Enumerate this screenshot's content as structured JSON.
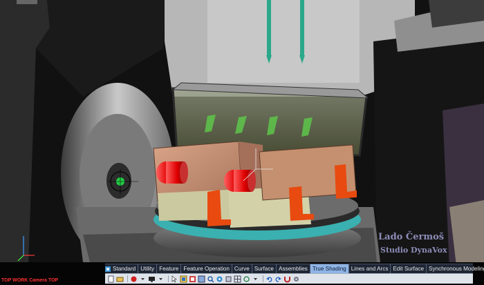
{
  "viewport": {
    "view_label": "TOP WORK Camera TOP"
  },
  "watermark": {
    "name": "Lado Čermoš",
    "studio": "Studio DynaVox"
  },
  "ribbon": {
    "tabs": [
      {
        "label": "Standard",
        "active": false
      },
      {
        "label": "Utility",
        "active": false
      },
      {
        "label": "Feature",
        "active": false
      },
      {
        "label": "Feature Operation",
        "active": false
      },
      {
        "label": "Curve",
        "active": false
      },
      {
        "label": "Surface",
        "active": false
      },
      {
        "label": "Assemblies",
        "active": false
      },
      {
        "label": "True Shading",
        "active": true
      },
      {
        "label": "Lines and Arcs",
        "active": false
      },
      {
        "label": "Edit Surface",
        "active": false
      },
      {
        "label": "Synchronous Modeling",
        "active": false
      }
    ]
  },
  "toolbar": {
    "icons": [
      "new-file-icon",
      "open-file-icon",
      "record-icon",
      "dropdown-icon",
      "monitor-icon",
      "dropdown-icon",
      "pointer-icon",
      "select-icon",
      "shading-icon",
      "render-icon",
      "zoom-icon",
      "pan-icon",
      "view-cube-icon",
      "grid-icon",
      "refresh-icon",
      "dropdown-icon",
      "undo-icon",
      "redo-icon",
      "magnet-icon",
      "settings-icon"
    ]
  },
  "colors": {
    "tab_active_bg": "#8fb4e6",
    "tab_bar_bg": "#1e2634",
    "toolbar_bg": "#dfe3ea",
    "watermark": "#8c8cb8",
    "view_label": "#ff3030"
  }
}
